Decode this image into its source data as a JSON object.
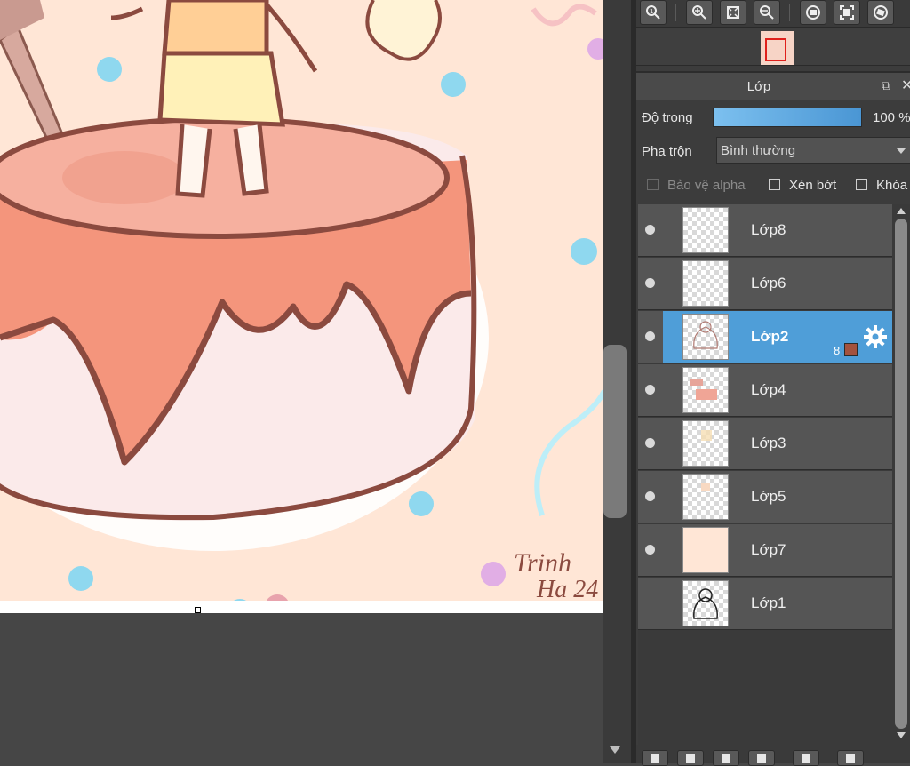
{
  "canvas": {
    "signature_line1": "Trinh",
    "signature_line2": "Ha 24"
  },
  "toolbar": {
    "icons": [
      "zoom-actual-icon",
      "zoom-in-icon",
      "fit-screen-icon",
      "zoom-out-icon",
      "rotate-left-icon",
      "fullscreen-icon",
      "rotate-right-icon"
    ]
  },
  "layer_panel": {
    "title": "Lớp",
    "opacity_label": "Độ trong",
    "opacity_value": "100 %",
    "opacity_fraction": 1.0,
    "blend_label": "Pha trộn",
    "blend_value": "Bình thường",
    "protect_alpha_label": "Bảo vệ alpha",
    "clipping_label": "Xén bớt",
    "lock_label": "Khóa",
    "selected_clip_count": "8",
    "selected_color": "#a3523e",
    "layers": [
      {
        "name": "Lớp8",
        "visible": true,
        "selected": false
      },
      {
        "name": "Lớp6",
        "visible": true,
        "selected": false
      },
      {
        "name": "Lớp2",
        "visible": true,
        "selected": true
      },
      {
        "name": "Lớp4",
        "visible": true,
        "selected": false
      },
      {
        "name": "Lớp3",
        "visible": true,
        "selected": false
      },
      {
        "name": "Lớp5",
        "visible": true,
        "selected": false
      },
      {
        "name": "Lớp7",
        "visible": true,
        "selected": false
      },
      {
        "name": "Lớp1",
        "visible": false,
        "selected": false
      }
    ]
  },
  "colors": {
    "accent": "#4f9ed8",
    "panel_bg": "#3c3c3c",
    "canvas_bg": "#ffe6d6"
  }
}
